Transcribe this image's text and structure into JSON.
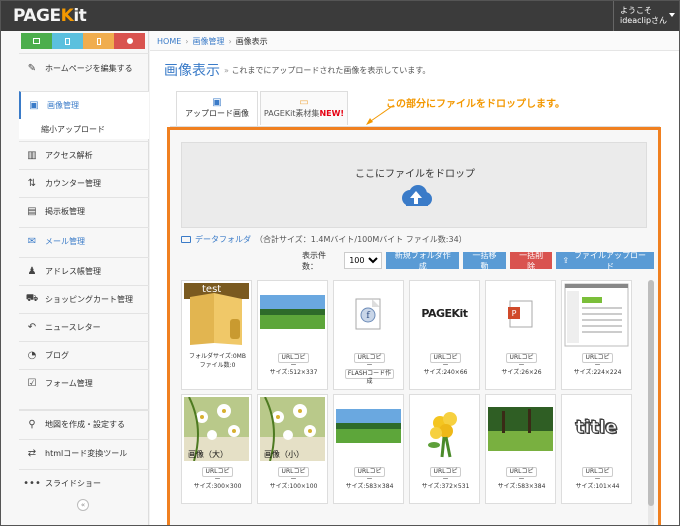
{
  "header": {
    "logo_main": "PAGE",
    "logo_accent": "K",
    "logo_tail": "it",
    "welcome": "ようこそ",
    "username": "ideaclipさん"
  },
  "quick_buttons": [
    {
      "icon": "monitor-icon",
      "color": "#4cae4c"
    },
    {
      "icon": "tablet-icon",
      "color": "#5bc0de"
    },
    {
      "icon": "phone-icon",
      "color": "#f0ad4e"
    },
    {
      "icon": "help-icon",
      "color": "#d9534f"
    }
  ],
  "sidebar": {
    "items": [
      {
        "label": "ホームページを編集する",
        "icon": "edit-icon"
      },
      {
        "label": "画像管理",
        "icon": "image-icon"
      },
      {
        "label": "縮小アップロード",
        "icon": ""
      },
      {
        "label": "アクセス解析",
        "icon": "bar-chart-icon"
      },
      {
        "label": "カウンター管理",
        "icon": "counter-icon"
      },
      {
        "label": "掲示板管理",
        "icon": "board-icon"
      },
      {
        "label": "メール管理",
        "icon": "mail-icon"
      },
      {
        "label": "アドレス帳管理",
        "icon": "users-icon"
      },
      {
        "label": "ショッピングカート管理",
        "icon": "cart-icon"
      },
      {
        "label": "ニュースレター",
        "icon": "reply-icon"
      },
      {
        "label": "ブログ",
        "icon": "rss-icon"
      },
      {
        "label": "フォーム管理",
        "icon": "checkbox-icon"
      },
      {
        "label": "地図を作成・設定する",
        "icon": "map-marker-icon"
      },
      {
        "label": "htmlコード変換ツール",
        "icon": "exchange-icon"
      },
      {
        "label": "スライドショー",
        "icon": "ellipsis-icon"
      }
    ],
    "collapse": "«"
  },
  "breadcrumb": {
    "home": "HOME",
    "parent": "画像管理",
    "current": "画像表示"
  },
  "page": {
    "title": "画像表示",
    "description": "これまでにアップロードされた画像を表示しています。"
  },
  "tabs": [
    {
      "label": "アップロード画像",
      "badge": ""
    },
    {
      "label": "PAGEKit素材集",
      "badge": "NEW!"
    }
  ],
  "annotation": "この部分にファイルをドロップします。",
  "dropzone": {
    "text": "ここにファイルをドロップ"
  },
  "folder": {
    "name": "データフォルダ",
    "info": "（合計サイズ：1.4Mバイト/100Mバイト ファイル数:34）"
  },
  "toolbar": {
    "count_label": "表示件数：",
    "count_value": "100",
    "new_folder": "新規フォルダ作成",
    "bulk_move": "一括移動",
    "bulk_delete": "一括削除",
    "file_upload": "ファイルアップロード"
  },
  "url_copy_label": "URLコピー",
  "flash_copy_label": "FLASHコード作成",
  "items": [
    {
      "kind": "folder",
      "folder_label": "test",
      "line1": "フォルダサイズ:0MB",
      "line2": "ファイル数:0"
    },
    {
      "kind": "image",
      "thumb": "field",
      "size": "サイズ:512×337"
    },
    {
      "kind": "flash",
      "thumb": "flash",
      "size": ""
    },
    {
      "kind": "image",
      "thumb": "pagekit-logo",
      "logo_text": "PAGEKit",
      "size": "サイズ:240×66"
    },
    {
      "kind": "image",
      "thumb": "ppt",
      "size": "サイズ:26×26"
    },
    {
      "kind": "image",
      "thumb": "screenshot",
      "size": "サイズ:224×224"
    },
    {
      "kind": "image",
      "thumb": "flowers",
      "caption_text": "画像（大）",
      "size": "サイズ:300×300"
    },
    {
      "kind": "image",
      "thumb": "flowers",
      "caption_text": "画像（小）",
      "size": "サイズ:100×100"
    },
    {
      "kind": "image",
      "thumb": "field",
      "size": "サイズ:583×384"
    },
    {
      "kind": "image",
      "thumb": "yellow-flowers",
      "size": "サイズ:372×531"
    },
    {
      "kind": "image",
      "thumb": "forest",
      "size": "サイズ:583×384"
    },
    {
      "kind": "image",
      "thumb": "title-text",
      "logo_text": "title",
      "size": "サイズ:101×44"
    }
  ]
}
